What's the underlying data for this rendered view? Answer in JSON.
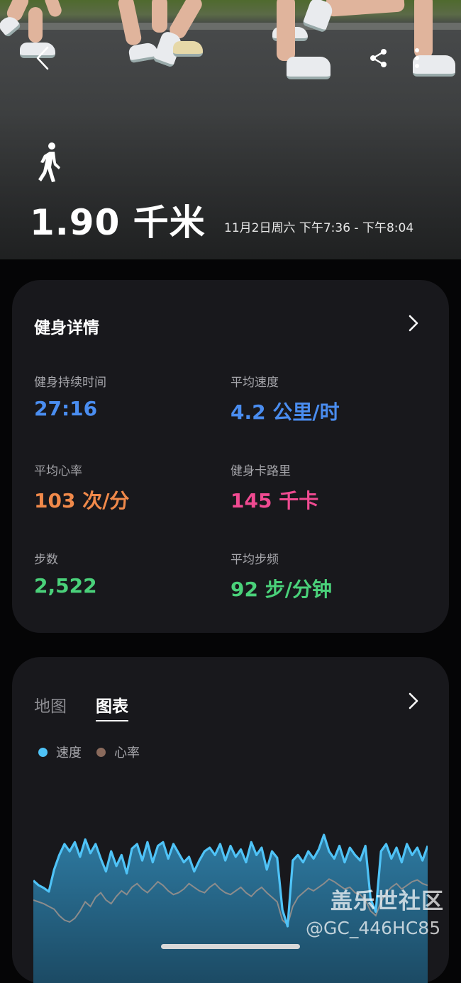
{
  "header": {
    "icons": {
      "back": "chevron-left-icon",
      "share": "share-icon",
      "more": "more-vertical-icon",
      "activity": "walking-icon"
    },
    "distance": "1.90 千米",
    "session_time": "11月2日周六 下午7:36 - 下午8:04"
  },
  "details": {
    "title": "健身详情",
    "stats": [
      {
        "label": "健身持续时间",
        "value": "27:16",
        "color": "#4a8df0"
      },
      {
        "label": "平均速度",
        "value": "4.2 公里/时",
        "color": "#4a8df0"
      },
      {
        "label": "平均心率",
        "value": "103 次/分",
        "color": "#f0894a"
      },
      {
        "label": "健身卡路里",
        "value": "145 千卡",
        "color": "#f04a91"
      },
      {
        "label": "步数",
        "value": "2,522",
        "color": "#4ad17a"
      },
      {
        "label": "平均步频",
        "value": "92 步/分钟",
        "color": "#4ad17a"
      }
    ]
  },
  "chart_panel": {
    "tabs": [
      "地图",
      "图表"
    ],
    "active_tab": "图表",
    "legend": [
      {
        "label": "速度",
        "color": "#4fc3f7"
      },
      {
        "label": "心率",
        "color": "#8a6a5c"
      }
    ]
  },
  "chart_data": {
    "type": "line",
    "title": "",
    "xlabel": "",
    "ylabel": "",
    "series": [
      {
        "name": "速度",
        "color": "#4fc3f7",
        "values": [
          0.5,
          0.45,
          0.42,
          0.38,
          0.62,
          0.78,
          0.9,
          0.82,
          0.92,
          0.76,
          0.95,
          0.8,
          0.9,
          0.74,
          0.6,
          0.82,
          0.66,
          0.78,
          0.58,
          0.85,
          0.9,
          0.72,
          0.92,
          0.7,
          0.88,
          0.92,
          0.74,
          0.9,
          0.8,
          0.7,
          0.76,
          0.6,
          0.72,
          0.82,
          0.86,
          0.78,
          0.9,
          0.72,
          0.88,
          0.76,
          0.84,
          0.7,
          0.92,
          0.78,
          0.86,
          0.62,
          0.82,
          0.75,
          0.18,
          0.0,
          0.72,
          0.78,
          0.7,
          0.82,
          0.74,
          0.84,
          1.0,
          0.82,
          0.74,
          0.88,
          0.7,
          0.86,
          0.78,
          0.72,
          0.88,
          0.3,
          0.16,
          0.82,
          0.9,
          0.74,
          0.86,
          0.7,
          0.9,
          0.78,
          0.86,
          0.72,
          0.88
        ]
      },
      {
        "name": "心率",
        "color": "#8a6a5c",
        "values": [
          0.52,
          0.5,
          0.48,
          0.45,
          0.42,
          0.35,
          0.3,
          0.28,
          0.32,
          0.4,
          0.5,
          0.45,
          0.55,
          0.6,
          0.52,
          0.48,
          0.56,
          0.62,
          0.58,
          0.66,
          0.7,
          0.64,
          0.6,
          0.66,
          0.72,
          0.68,
          0.62,
          0.58,
          0.6,
          0.64,
          0.7,
          0.66,
          0.62,
          0.6,
          0.66,
          0.7,
          0.64,
          0.6,
          0.58,
          0.62,
          0.66,
          0.6,
          0.56,
          0.62,
          0.66,
          0.6,
          0.55,
          0.5,
          0.3,
          0.25,
          0.45,
          0.55,
          0.6,
          0.65,
          0.62,
          0.66,
          0.7,
          0.75,
          0.72,
          0.68,
          0.64,
          0.66,
          0.6,
          0.58,
          0.52,
          0.4,
          0.35,
          0.5,
          0.6,
          0.66,
          0.7,
          0.64,
          0.68,
          0.72,
          0.74,
          0.7,
          0.68
        ]
      }
    ]
  }
}
